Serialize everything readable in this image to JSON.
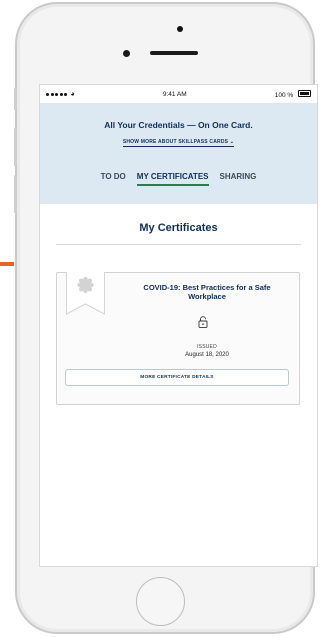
{
  "status_bar": {
    "time": "9:41 AM",
    "battery": "100 %"
  },
  "banner": {
    "title": "All Your Credentials — On One Card.",
    "link": "SHOW MORE ABOUT SKILLPASS CARDS"
  },
  "tabs": [
    {
      "label": "TO DO",
      "active": false
    },
    {
      "label": "MY CERTIFICATES",
      "active": true
    },
    {
      "label": "SHARING",
      "active": false
    }
  ],
  "page_title": "My Certificates",
  "certificate": {
    "title": "COVID-19: Best Practices for a Safe Workplace",
    "status_label": "ISSUED",
    "issued_date": "August 18, 2020",
    "details_button": "MORE CERTIFICATE DETAILS"
  },
  "colors": {
    "accent_orange": "#e8622a",
    "brand_navy": "#0f2f57",
    "banner_blue": "#dce9f3",
    "tab_underline_green": "#2e7d4f"
  }
}
